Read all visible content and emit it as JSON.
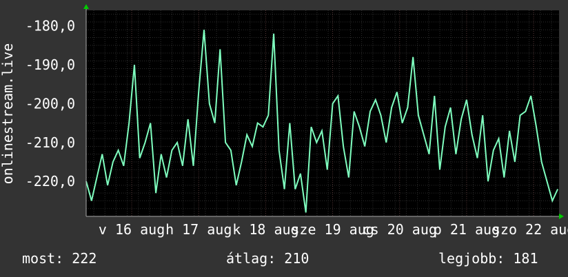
{
  "chart_data": {
    "type": "line",
    "ylabel": "onlinestream.live",
    "y_ticks": [
      "-180,0",
      "-190,0",
      "-200,0",
      "-210,0",
      "-220,0"
    ],
    "y_tick_values": [
      -180,
      -190,
      -200,
      -210,
      -220
    ],
    "ylim": [
      -229,
      -176
    ],
    "x_ticks": [
      "v 16 aug",
      "h 17 aug",
      "k 18 aug",
      "sze 19 aug",
      "cs 20 aug",
      "p 21 aug",
      "szo 22 aug"
    ],
    "x_tick_days": [
      15.9,
      16.9,
      17.9,
      18.9,
      19.9,
      20.9,
      21.9
    ],
    "xlim": [
      15.22,
      22.28
    ],
    "grid": true,
    "colors": {
      "background": "#333333",
      "plot_background": "#000000",
      "line": "#7fffbf",
      "grid": "#3a3a3a",
      "arrow": "#00cc00"
    },
    "series": [
      {
        "x": [
          15.22,
          15.3,
          15.38,
          15.46,
          15.54,
          15.62,
          15.7,
          15.78,
          15.86,
          15.94,
          16.02,
          16.1,
          16.18,
          16.26,
          16.34,
          16.42,
          16.5,
          16.58,
          16.66,
          16.74,
          16.82,
          16.9,
          16.98,
          17.06,
          17.14,
          17.22,
          17.3,
          17.38,
          17.46,
          17.54,
          17.62,
          17.7,
          17.78,
          17.86,
          17.94,
          18.02,
          18.1,
          18.18,
          18.26,
          18.34,
          18.42,
          18.5,
          18.58,
          18.66,
          18.74,
          18.82,
          18.9,
          18.98,
          19.06,
          19.14,
          19.22,
          19.3,
          19.38,
          19.46,
          19.54,
          19.62,
          19.7,
          19.78,
          19.86,
          19.94,
          20.02,
          20.1,
          20.18,
          20.26,
          20.34,
          20.42,
          20.5,
          20.58,
          20.66,
          20.74,
          20.82,
          20.9,
          20.98,
          21.06,
          21.14,
          21.22,
          21.3,
          21.38,
          21.46,
          21.54,
          21.62,
          21.7,
          21.78,
          21.86,
          21.94,
          22.02,
          22.1,
          22.18,
          22.26
        ],
        "values": [
          -220,
          -225,
          -219,
          -213,
          -221,
          -215,
          -212,
          -216,
          -205,
          -190,
          -214,
          -210,
          -205,
          -223,
          -213,
          -219,
          -212,
          -210,
          -216,
          -204,
          -216,
          -197,
          -181,
          -200,
          -205,
          -186,
          -210,
          -212,
          -221,
          -215,
          -208,
          -211,
          -205,
          -206,
          -203,
          -182,
          -212,
          -222,
          -205,
          -222,
          -218,
          -228,
          -206,
          -210,
          -207,
          -217,
          -200,
          -198,
          -211,
          -219,
          -202,
          -206,
          -211,
          -202,
          -199,
          -203,
          -210,
          -201,
          -197,
          -205,
          -201,
          -188,
          -203,
          -208,
          -213,
          -198,
          -217,
          -206,
          -201,
          -213,
          -204,
          -199,
          -208,
          -214,
          -203,
          -220,
          -212,
          -209,
          -219,
          -207,
          -215,
          -203,
          -202,
          -198,
          -206,
          -215,
          -220,
          -225,
          -222
        ]
      }
    ]
  },
  "stats": {
    "current": "most: 222",
    "average": "átlag: 210",
    "best": "legjobb: 181"
  }
}
